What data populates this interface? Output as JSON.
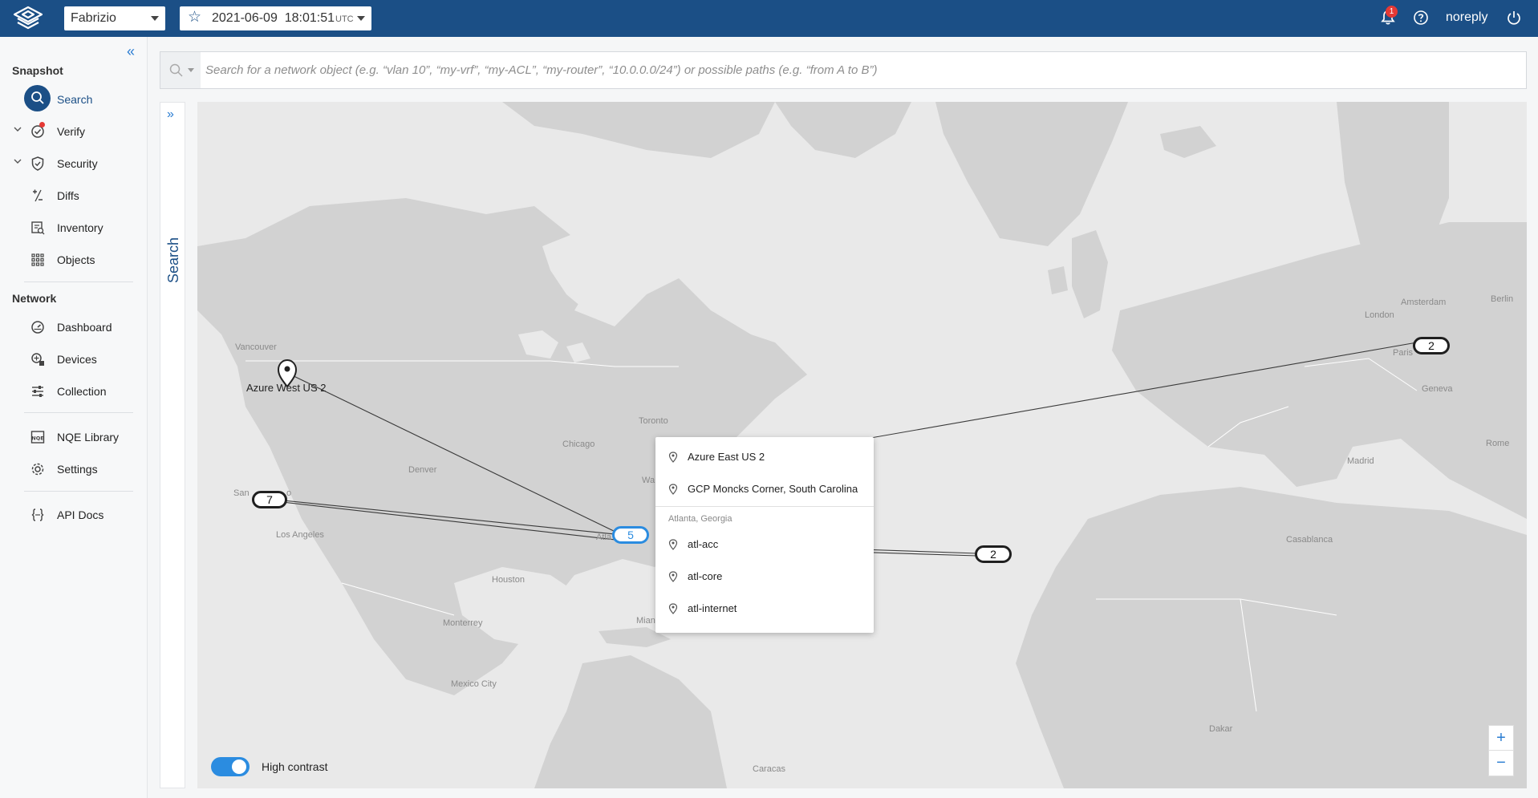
{
  "topbar": {
    "network": "Fabrizio",
    "snapshot_date": "2021-06-09",
    "snapshot_time": "18:01:51",
    "snapshot_tz": "UTC",
    "notification_count": "1",
    "user": "noreply"
  },
  "sidebar": {
    "snapshot_title": "Snapshot",
    "network_title": "Network",
    "items": {
      "search": "Search",
      "verify": "Verify",
      "security": "Security",
      "diffs": "Diffs",
      "inventory": "Inventory",
      "objects": "Objects",
      "dashboard": "Dashboard",
      "devices": "Devices",
      "collection": "Collection",
      "nqe_library": "NQE Library",
      "settings": "Settings",
      "api_docs": "API Docs"
    }
  },
  "search": {
    "placeholder": "Search for a network object (e.g. “vlan 10”, “my-vrf”, “my-ACL”, “my-router”, “10.0.0.0/24”) or possible paths (e.g. “from A to B”)",
    "side_tab": "Search"
  },
  "map": {
    "cities": {
      "vancouver": "Vancouver",
      "san_francisco": "San",
      "san_francisco_tail": "o",
      "los_angeles": "Los Angeles",
      "denver": "Denver",
      "chicago": "Chicago",
      "toronto": "Toronto",
      "washington": "Wa",
      "atlanta": "Atla",
      "houston": "Houston",
      "monterrey": "Monterrey",
      "mexico_city": "Mexico City",
      "miami": "Mian",
      "caracas": "Caracas",
      "london": "London",
      "amsterdam": "Amsterdam",
      "berlin": "Berlin",
      "paris": "Paris",
      "geneva": "Geneva",
      "madrid": "Madrid",
      "rome": "Rome",
      "casablanca": "Casablanca",
      "dakar": "Dakar"
    },
    "marker_label": "Azure West US 2",
    "clusters": {
      "west": "7",
      "atlanta": "5",
      "europe": "2",
      "atlantic": "2"
    },
    "high_contrast_label": "High contrast",
    "zoom_in": "+",
    "zoom_out": "−"
  },
  "popup": {
    "items": [
      "Azure East US 2",
      "GCP Moncks Corner, South Carolina"
    ],
    "group_label": "Atlanta, Georgia",
    "group_items": [
      "atl-acc",
      "atl-core",
      "atl-internet"
    ]
  },
  "colors": {
    "brand": "#1b4f86",
    "accent": "#2b8ce0",
    "alert": "#e53935"
  }
}
